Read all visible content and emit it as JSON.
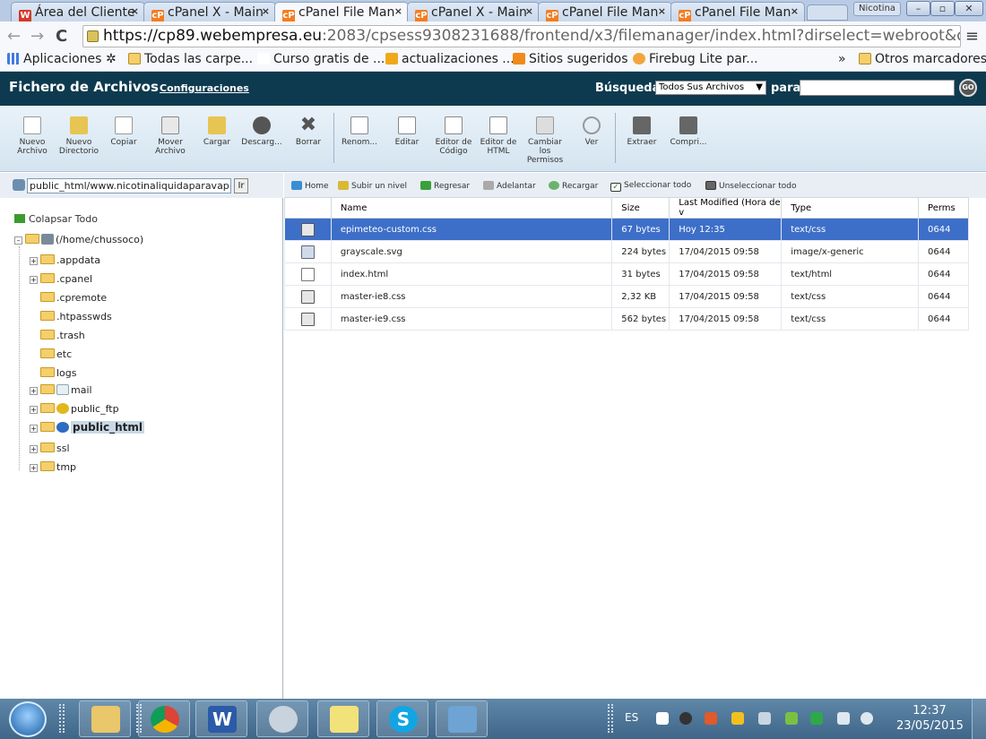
{
  "browser": {
    "tabs": [
      {
        "label": "Área del Cliente",
        "favicon": "W"
      },
      {
        "label": "cPanel X - Main",
        "favicon": "cP"
      },
      {
        "label": "cPanel File Man",
        "favicon": "cP",
        "active": true
      },
      {
        "label": "cPanel X - Main",
        "favicon": "cP"
      },
      {
        "label": "cPanel File Man",
        "favicon": "cP"
      },
      {
        "label": "cPanel File Man",
        "favicon": "cP"
      }
    ],
    "profile": "Nicotina",
    "url_host": "https://cp89.webempresa.eu",
    "url_rest": ":2083/cpsess9308231688/frontend/x3/filemanager/index.html?dirselect=webroot&domainselect=nicotinali",
    "bookmarks": [
      "Aplicaciones",
      "Todas las carpe...",
      "Curso gratis de ...",
      "actualizaciones ...",
      "Sitios sugeridos",
      "Firebug Lite par..."
    ],
    "bookmarks_more": "»",
    "other_bookmarks": "Otros marcadores"
  },
  "header": {
    "title": "Fichero de Archivos",
    "config_link": "Configuraciones",
    "search_label": "Búsqueda",
    "search_scope": "Todos Sus Archivos",
    "search_para": "para",
    "go": "GO"
  },
  "toolbar": [
    {
      "label": "Nuevo Archivo",
      "icon": "new-file-icon"
    },
    {
      "label": "Nuevo Directorio",
      "icon": "new-folder-icon"
    },
    {
      "label": "Copiar",
      "icon": "copy-icon"
    },
    {
      "label": "Mover Archivo",
      "icon": "move-icon"
    },
    {
      "label": "Cargar",
      "icon": "upload-icon"
    },
    {
      "label": "Descarg...",
      "icon": "download-icon"
    },
    {
      "label": "Borrar",
      "icon": "delete-icon"
    },
    {
      "label": "Renom...",
      "icon": "rename-icon"
    },
    {
      "label": "Editar",
      "icon": "edit-icon"
    },
    {
      "label": "Editor de Código",
      "icon": "code-editor-icon"
    },
    {
      "label": "Editor de HTML",
      "icon": "html-editor-icon"
    },
    {
      "label": "Cambiar los Permisos",
      "icon": "permissions-icon"
    },
    {
      "label": "Ver",
      "icon": "view-icon"
    },
    {
      "label": "Extraer",
      "icon": "extract-icon"
    },
    {
      "label": "Compri...",
      "icon": "compress-icon"
    }
  ],
  "left": {
    "path_value": "public_html/www.nicotinaliquidaparavap",
    "go_label": "Ir",
    "collapse_all": "Colapsar Todo",
    "root": "(/home/chussoco)",
    "folders": [
      ".appdata",
      ".cpanel",
      ".cpremote",
      ".htpasswds",
      ".trash",
      "etc",
      "logs",
      "mail",
      "public_ftp",
      "public_html",
      "ssl",
      "tmp"
    ]
  },
  "nav": [
    "Home",
    "Subir un nivel",
    "Regresar",
    "Adelantar",
    "Recargar",
    "Seleccionar todo",
    "Unseleccionar todo"
  ],
  "table": {
    "columns": [
      "Name",
      "Size",
      "Last Modified (Hora de v",
      "Type",
      "Perms"
    ],
    "rows": [
      {
        "name": "epimeteo-custom.css",
        "size": "67 bytes",
        "modified": "Hoy 12:35",
        "type": "text/css",
        "perms": "0644"
      },
      {
        "name": "grayscale.svg",
        "size": "224 bytes",
        "modified": "17/04/2015 09:58",
        "type": "image/x-generic",
        "perms": "0644"
      },
      {
        "name": "index.html",
        "size": "31 bytes",
        "modified": "17/04/2015 09:58",
        "type": "text/html",
        "perms": "0644"
      },
      {
        "name": "master-ie8.css",
        "size": "2,32 KB",
        "modified": "17/04/2015 09:58",
        "type": "text/css",
        "perms": "0644"
      },
      {
        "name": "master-ie9.css",
        "size": "562 bytes",
        "modified": "17/04/2015 09:58",
        "type": "text/css",
        "perms": "0644"
      }
    ]
  },
  "taskbar": {
    "lang": "ES",
    "clock_time": "12:37",
    "clock_date": "23/05/2015"
  },
  "colors": {
    "header_bg": "#0e3a4f",
    "selected_row": "#3d6fc9"
  }
}
